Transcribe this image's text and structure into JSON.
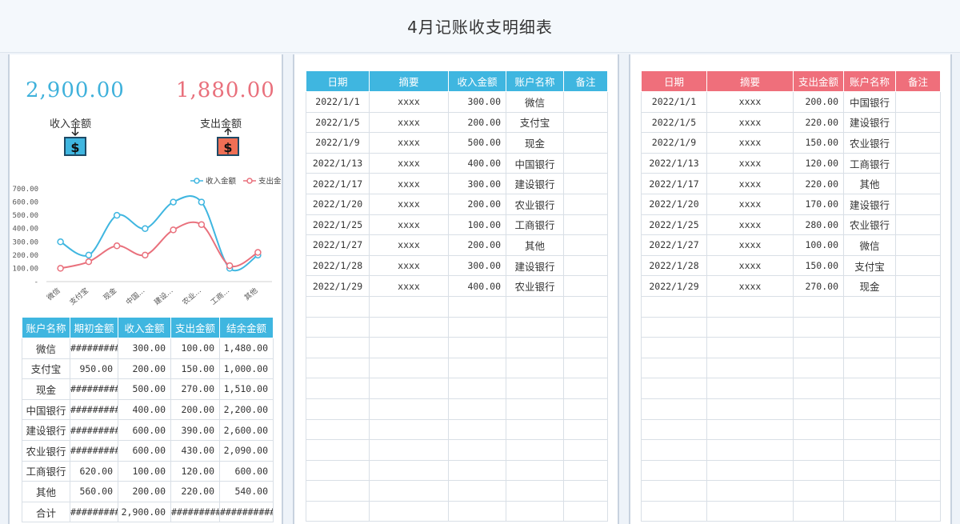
{
  "title": "4月记账收支明细表",
  "summary": {
    "income_total": "2,900.00",
    "expense_total": "1,880.00",
    "income_label": "收入金额",
    "expense_label": "支出金额",
    "icon_income": "money-deposit-icon",
    "icon_expense": "money-withdraw-icon"
  },
  "chart_data": {
    "type": "line",
    "categories": [
      "微信",
      "支付宝",
      "现金",
      "中国…",
      "建设…",
      "农业…",
      "工商…",
      "其他"
    ],
    "series": [
      {
        "name": "收入金额",
        "color": "#3fb6e0",
        "values": [
          300,
          200,
          500,
          400,
          600,
          600,
          100,
          200
        ]
      },
      {
        "name": "支出金额",
        "color": "#e9707c",
        "values": [
          100,
          150,
          270,
          200,
          390,
          430,
          120,
          220
        ]
      }
    ],
    "y_ticks": [
      "-",
      "100.00",
      "200.00",
      "300.00",
      "400.00",
      "500.00",
      "600.00",
      "700.00"
    ],
    "ylim": [
      0,
      700
    ],
    "legend_labels": [
      "收入金额",
      "支出金"
    ],
    "legend": "top-right"
  },
  "account_table": {
    "headers": [
      "账户名称",
      "期初金额",
      "收入金额",
      "支出金额",
      "结余金额"
    ],
    "rows": [
      [
        "微信",
        "#########",
        "300.00",
        "100.00",
        "1,480.00"
      ],
      [
        "支付宝",
        "950.00",
        "200.00",
        "150.00",
        "1,000.00"
      ],
      [
        "现金",
        "#########",
        "500.00",
        "270.00",
        "1,510.00"
      ],
      [
        "中国银行",
        "#########",
        "400.00",
        "200.00",
        "2,200.00"
      ],
      [
        "建设银行",
        "#########",
        "600.00",
        "390.00",
        "2,600.00"
      ],
      [
        "农业银行",
        "#########",
        "600.00",
        "430.00",
        "2,090.00"
      ],
      [
        "工商银行",
        "620.00",
        "100.00",
        "120.00",
        "600.00"
      ],
      [
        "其他",
        "560.00",
        "200.00",
        "220.00",
        "540.00"
      ],
      [
        "合计",
        "#########",
        "2,900.00",
        "#########",
        "##########"
      ]
    ]
  },
  "income_table": {
    "headers": [
      "日期",
      "摘要",
      "收入金额",
      "账户名称",
      "备注"
    ],
    "rows": [
      [
        "2022/1/1",
        "xxxx",
        "300.00",
        "微信",
        ""
      ],
      [
        "2022/1/5",
        "xxxx",
        "200.00",
        "支付宝",
        ""
      ],
      [
        "2022/1/9",
        "xxxx",
        "500.00",
        "现金",
        ""
      ],
      [
        "2022/1/13",
        "xxxx",
        "400.00",
        "中国银行",
        ""
      ],
      [
        "2022/1/17",
        "xxxx",
        "300.00",
        "建设银行",
        ""
      ],
      [
        "2022/1/20",
        "xxxx",
        "200.00",
        "农业银行",
        ""
      ],
      [
        "2022/1/25",
        "xxxx",
        "100.00",
        "工商银行",
        ""
      ],
      [
        "2022/1/27",
        "xxxx",
        "200.00",
        "其他",
        ""
      ],
      [
        "2022/1/28",
        "xxxx",
        "300.00",
        "建设银行",
        ""
      ],
      [
        "2022/1/29",
        "xxxx",
        "400.00",
        "农业银行",
        ""
      ]
    ],
    "blank_rows": 11
  },
  "expense_table": {
    "headers": [
      "日期",
      "摘要",
      "支出金额",
      "账户名称",
      "备注"
    ],
    "rows": [
      [
        "2022/1/1",
        "xxxx",
        "200.00",
        "中国银行",
        ""
      ],
      [
        "2022/1/5",
        "xxxx",
        "220.00",
        "建设银行",
        ""
      ],
      [
        "2022/1/9",
        "xxxx",
        "150.00",
        "农业银行",
        ""
      ],
      [
        "2022/1/13",
        "xxxx",
        "120.00",
        "工商银行",
        ""
      ],
      [
        "2022/1/17",
        "xxxx",
        "220.00",
        "其他",
        ""
      ],
      [
        "2022/1/20",
        "xxxx",
        "170.00",
        "建设银行",
        ""
      ],
      [
        "2022/1/25",
        "xxxx",
        "280.00",
        "农业银行",
        ""
      ],
      [
        "2022/1/27",
        "xxxx",
        "100.00",
        "微信",
        ""
      ],
      [
        "2022/1/28",
        "xxxx",
        "150.00",
        "支付宝",
        ""
      ],
      [
        "2022/1/29",
        "xxxx",
        "270.00",
        "现金",
        ""
      ]
    ],
    "blank_rows": 11
  },
  "colors": {
    "income": "#3fb6e0",
    "expense": "#ef6f7b"
  }
}
